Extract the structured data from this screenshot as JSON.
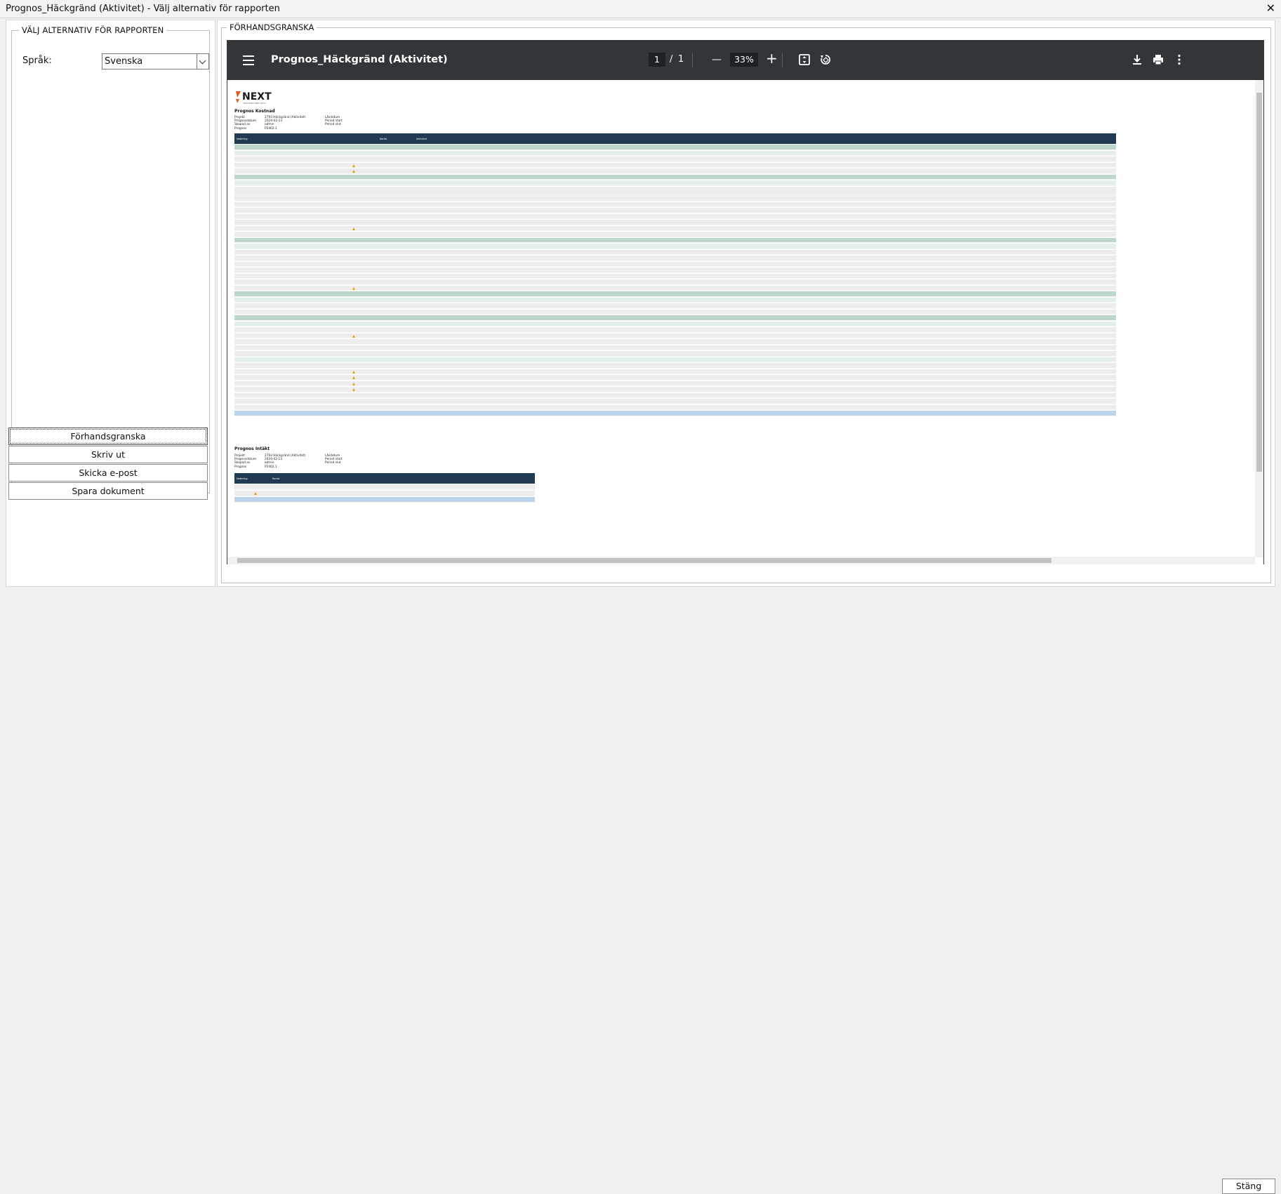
{
  "window": {
    "title": "Prognos_Häckgränd (Aktivitet) - Välj alternativ för rapporten",
    "close_glyph": "✕"
  },
  "options": {
    "legend": "VÄLJ ALTERNATIV FÖR RAPPORTEN",
    "language_label": "Språk:",
    "language_value": "Svenska"
  },
  "actions": {
    "preview": "Förhandsgranska",
    "print": "Skriv ut",
    "email": "Skicka e-post",
    "save": "Spara dokument"
  },
  "preview": {
    "legend": "FÖRHANDSGRANSKA"
  },
  "viewer": {
    "title": "Prognos_Häckgränd (Aktivitet)",
    "page_current": "1",
    "page_sep": "/",
    "page_total": "1",
    "zoom": "33%",
    "zoom_out_glyph": "—",
    "zoom_in_glyph": "+"
  },
  "report": {
    "logo_text": "NEXT",
    "logo_sub": "BUILDING NEW WAYS",
    "cost_heading": "Prognos Kostnad",
    "income_heading": "Prognos Intäkt",
    "meta_labels": [
      "Projekt",
      "Prognosdatum",
      "Skapad av",
      "Prognos"
    ],
    "meta_values": [
      "2793 Häckgränd (Aktivitet)",
      "2024-02-13",
      "admin",
      "P2402.1"
    ],
    "meta_labels2": [
      "Låsdatum",
      "Period start",
      "Period slut"
    ],
    "first_col_header": "Notering",
    "konto_header": "Konto",
    "aktivitet_header": "Aktivitet"
  },
  "footer": {
    "close": "Stäng"
  }
}
